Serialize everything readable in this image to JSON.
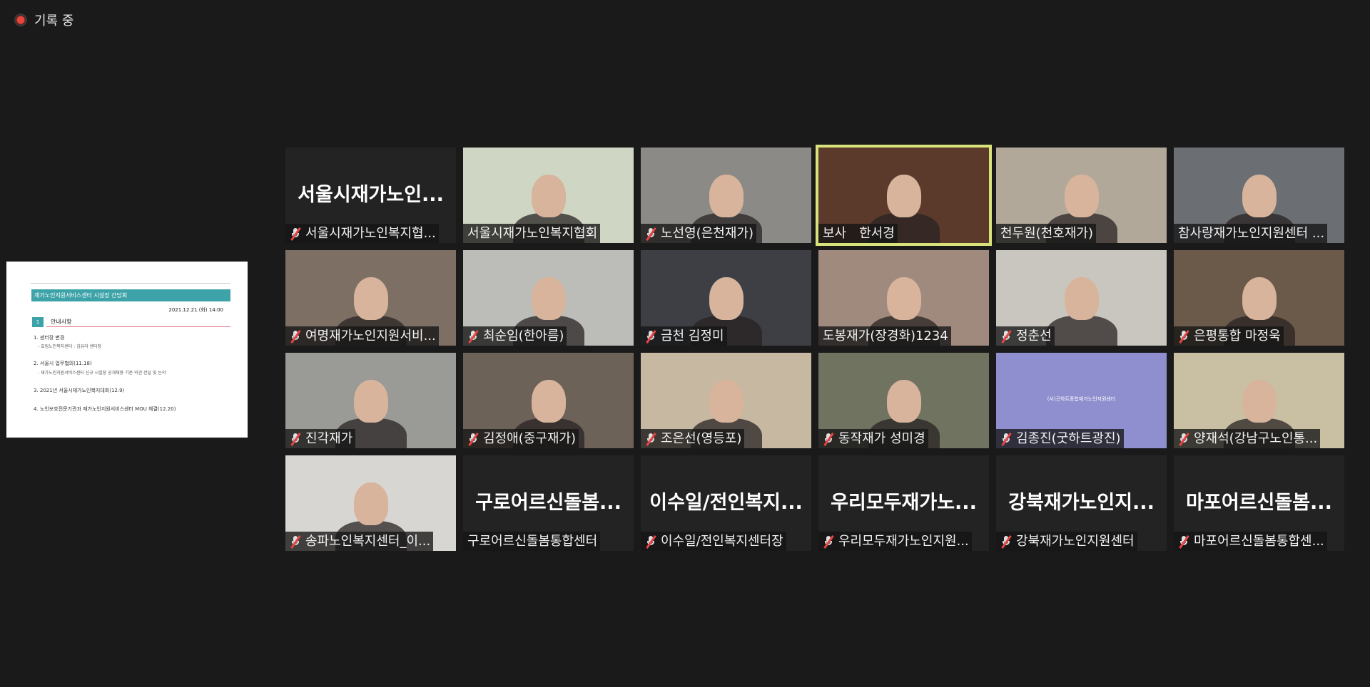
{
  "recording": {
    "label": "기록 중"
  },
  "shared_screen": {
    "title": "재가노인지원서비스센터 시설장 간담회",
    "date": "2021.12.21.(화) 14:00",
    "section_num": "1",
    "section_title": "안내사항",
    "items": [
      "1. 센터장 변경",
      "- 효림노인복지센터 : 김유라 센터장",
      "2. 서울시 업무협의(11.18)",
      "- 재가노인지원서비스센터 신규 시설장 공개채용 기준 의견 전달 및 논의",
      "3. 2021년 서울시재가노인복지대회(12.9)",
      "4. 노인보호전문기관과 재가노인지원서비스센터 MOU 체결(12.20)"
    ]
  },
  "participants": [
    {
      "name": "서울시재가노인복지협...",
      "big": "서울시재가노인...",
      "muted": true,
      "bg": "#232323"
    },
    {
      "name": "서울시재가노인복지협회",
      "muted": false,
      "bg": "#cfd6c3"
    },
    {
      "name": "노선영(은천재가)",
      "muted": true,
      "bg": "#8c8a86"
    },
    {
      "name": "보사　한서경",
      "muted": false,
      "bg": "#5b3a2c",
      "active": true
    },
    {
      "name": "천두원(천호재가)",
      "muted": false,
      "bg": "#b2a89a"
    },
    {
      "name": "참사랑재가노인지원센터 ...",
      "muted": false,
      "bg": "#6b6e72"
    },
    {
      "name": "여명재가노인지원서비...",
      "muted": true,
      "bg": "#7d6f64"
    },
    {
      "name": "최순임(한아름)",
      "muted": true,
      "bg": "#bcbcb8"
    },
    {
      "name": "금천 김정미",
      "muted": true,
      "bg": "#3e3f44"
    },
    {
      "name": "도봉재가(장경화)1234",
      "muted": false,
      "bg": "#a08a7e"
    },
    {
      "name": "정춘선",
      "muted": true,
      "bg": "#c9c6bf"
    },
    {
      "name": "은평통합 마정욱",
      "muted": true,
      "bg": "#6b5a4a"
    },
    {
      "name": "진각재가",
      "muted": true,
      "bg": "#9a9a96"
    },
    {
      "name": "김정애(중구재가)",
      "muted": true,
      "bg": "#6d6258"
    },
    {
      "name": "조은선(영등포)",
      "muted": true,
      "bg": "#c7b8a2"
    },
    {
      "name": "동작재가 성미경",
      "muted": true,
      "bg": "#6f7360"
    },
    {
      "name": "김종진(굿하트광진)",
      "muted": true,
      "bg": "#8f8fcf",
      "screen_text": "(사)굿하트종합재가노인지원센터"
    },
    {
      "name": "양재석(강남구노인통...",
      "muted": true,
      "bg": "#c9c0a4"
    },
    {
      "name": "송파노인복지센터_이...",
      "muted": true,
      "bg": "#d8d6d2"
    },
    {
      "name": "구로어르신돌봄통합센터",
      "big": "구로어르신돌봄...",
      "muted": false,
      "bg": "#232323"
    },
    {
      "name": "이수일/전인복지센터장",
      "big": "이수일/전인복지...",
      "muted": true,
      "bg": "#232323"
    },
    {
      "name": "우리모두재가노인지원...",
      "big": "우리모두재가노...",
      "muted": true,
      "bg": "#232323"
    },
    {
      "name": "강북재가노인지원센터",
      "big": "강북재가노인지...",
      "muted": true,
      "bg": "#232323"
    },
    {
      "name": "마포어르신돌봄통합센...",
      "big": "마포어르신돌봄...",
      "muted": true,
      "bg": "#232323"
    }
  ],
  "colors": {
    "active_outline": "#d8e27a",
    "mute_slash": "#e64545",
    "background": "#1a1a1a"
  }
}
